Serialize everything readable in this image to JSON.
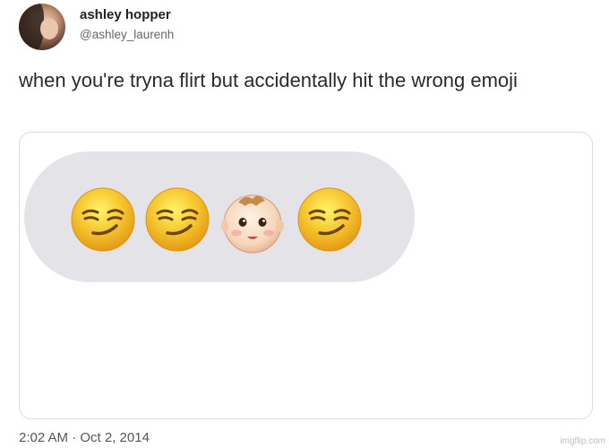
{
  "user": {
    "name": "ashley hopper",
    "handle": "@ashley_laurenh"
  },
  "tweet": {
    "text": "when you're tryna flirt but accidentally hit the wrong emoji",
    "timestamp": "2:02 AM · Oct 2, 2014"
  },
  "media": {
    "emojis": [
      "smirking-face-icon",
      "smirking-face-icon",
      "baby-face-icon",
      "smirking-face-icon"
    ],
    "bubble_color": "#e3e3e8"
  },
  "watermark": "imgflip.com"
}
